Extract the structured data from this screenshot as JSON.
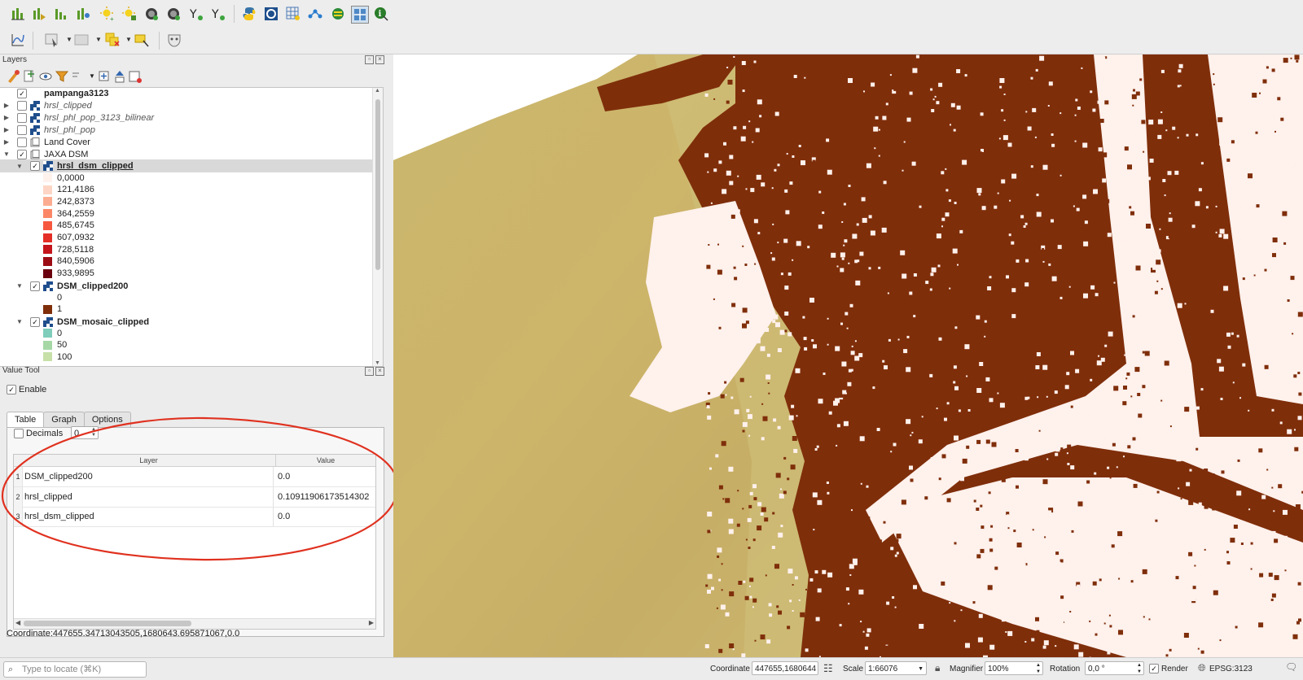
{
  "layers_panel": {
    "title": "Layers",
    "items": [
      {
        "label": "pampanga3123",
        "checked": true,
        "bold": true
      },
      {
        "label": "hrsl_clipped",
        "checked": false,
        "italic": true
      },
      {
        "label": "hrsl_phl_pop_3123_bilinear",
        "checked": false,
        "italic": true
      },
      {
        "label": "hrsl_phl_pop",
        "checked": false,
        "italic": true
      },
      {
        "label": "Land Cover",
        "checked": false
      },
      {
        "label": "JAXA DSM",
        "checked": true
      },
      {
        "label": "hrsl_dsm_clipped",
        "checked": true,
        "bold": true,
        "underline": true
      },
      {
        "label": "DSM_clipped200",
        "checked": true,
        "bold": true
      },
      {
        "label": "DSM_mosaic_clipped",
        "checked": true,
        "bold": true
      }
    ],
    "hrsl_dsm_legend": [
      {
        "label": "0,0000",
        "color": "#fff1ec"
      },
      {
        "label": "121,4186",
        "color": "#fdd5c4"
      },
      {
        "label": "242,8373",
        "color": "#fcad91"
      },
      {
        "label": "364,2559",
        "color": "#fb8767"
      },
      {
        "label": "485,6745",
        "color": "#f6573f"
      },
      {
        "label": "607,0932",
        "color": "#e42f27"
      },
      {
        "label": "728,5118",
        "color": "#c3151b"
      },
      {
        "label": "840,5906",
        "color": "#9c0c14"
      },
      {
        "label": "933,9895",
        "color": "#6a000d"
      }
    ],
    "dsm200_legend": [
      {
        "label": "0",
        "color": "#ffffff"
      },
      {
        "label": "1",
        "color": "#7f2e0a"
      }
    ],
    "mosaic_legend": [
      {
        "label": "0",
        "color": "#7fcdbb"
      },
      {
        "label": "50",
        "color": "#a6d8a6"
      },
      {
        "label": "100",
        "color": "#c7e0a8"
      }
    ]
  },
  "value_tool": {
    "title": "Value Tool",
    "enable_label": "Enable",
    "enable_checked": true,
    "tabs": [
      "Table",
      "Graph",
      "Options"
    ],
    "active_tab": "Table",
    "decimals_label": "Decimals",
    "decimals_value": "0",
    "columns": [
      "Layer",
      "Value"
    ],
    "rows": [
      {
        "num": "1",
        "layer": "DSM_clipped200",
        "value": "0.0"
      },
      {
        "num": "2",
        "layer": "hrsl_clipped",
        "value": "0.10911906173514302"
      },
      {
        "num": "3",
        "layer": "hrsl_dsm_clipped",
        "value": "0.0"
      }
    ],
    "coordinate_text": "Coordinate:447655.34713043505,1680643.695871067,0.0"
  },
  "status_bar": {
    "locate_placeholder": "Type to locate (⌘K)",
    "coordinate_label": "Coordinate",
    "coordinate_value": "447655,1680644",
    "scale_label": "Scale",
    "scale_value": "1:66076",
    "magnifier_label": "Magnifier",
    "magnifier_value": "100%",
    "rotation_label": "Rotation",
    "rotation_value": "0,0 °",
    "render_label": "Render",
    "render_checked": true,
    "crs": "EPSG:3123"
  },
  "colors": {
    "dsm_brown": "#7f2e0a",
    "nodata_pink": "#fff1ec",
    "dem_khaki": "#cdb670",
    "annotation_red": "#e0311f"
  },
  "icons": [
    "histogram-icon",
    "sun-icon",
    "globe-icon",
    "python-icon",
    "grid-icon",
    "network-icon",
    "info-icon",
    "chart-icon",
    "select-icon",
    "mask-icon"
  ]
}
